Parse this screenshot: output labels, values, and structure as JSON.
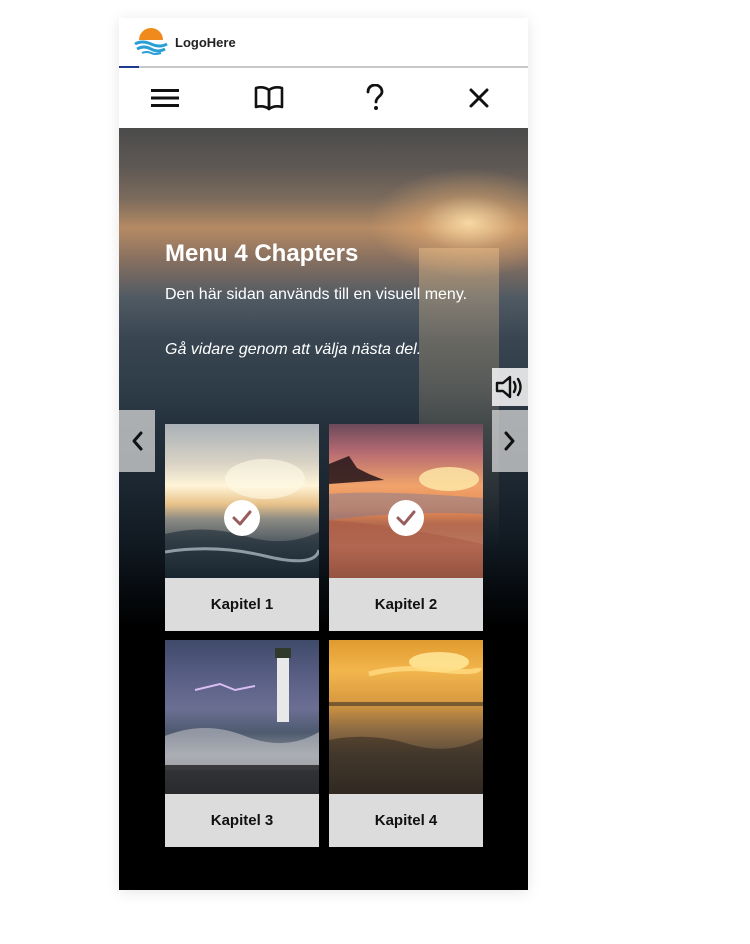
{
  "logo": {
    "text": "LogoHere"
  },
  "toolbar": {
    "items": [
      {
        "name": "menu",
        "icon": "hamburger-menu-icon"
      },
      {
        "name": "book",
        "icon": "open-book-icon"
      },
      {
        "name": "help",
        "icon": "question-mark-icon"
      },
      {
        "name": "close",
        "icon": "close-icon"
      }
    ]
  },
  "hero": {
    "title": "Menu 4 Chapters",
    "description": "Den här sidan används till en visuell meny.",
    "hint": "Gå vidare genom att välja nästa del."
  },
  "audio": {
    "icon": "speaker-icon"
  },
  "navigation": {
    "prev_icon": "chevron-left-icon",
    "next_icon": "chevron-right-icon"
  },
  "chapters": [
    {
      "label": "Kapitel 1",
      "completed": true
    },
    {
      "label": "Kapitel 2",
      "completed": true
    },
    {
      "label": "Kapitel 3",
      "completed": false
    },
    {
      "label": "Kapitel 4",
      "completed": false
    }
  ],
  "colors": {
    "logo_orange": "#f08a1c",
    "logo_blue": "#2a9fd6",
    "check_color": "#9a5d5d",
    "label_background": "#dcdcdc"
  }
}
